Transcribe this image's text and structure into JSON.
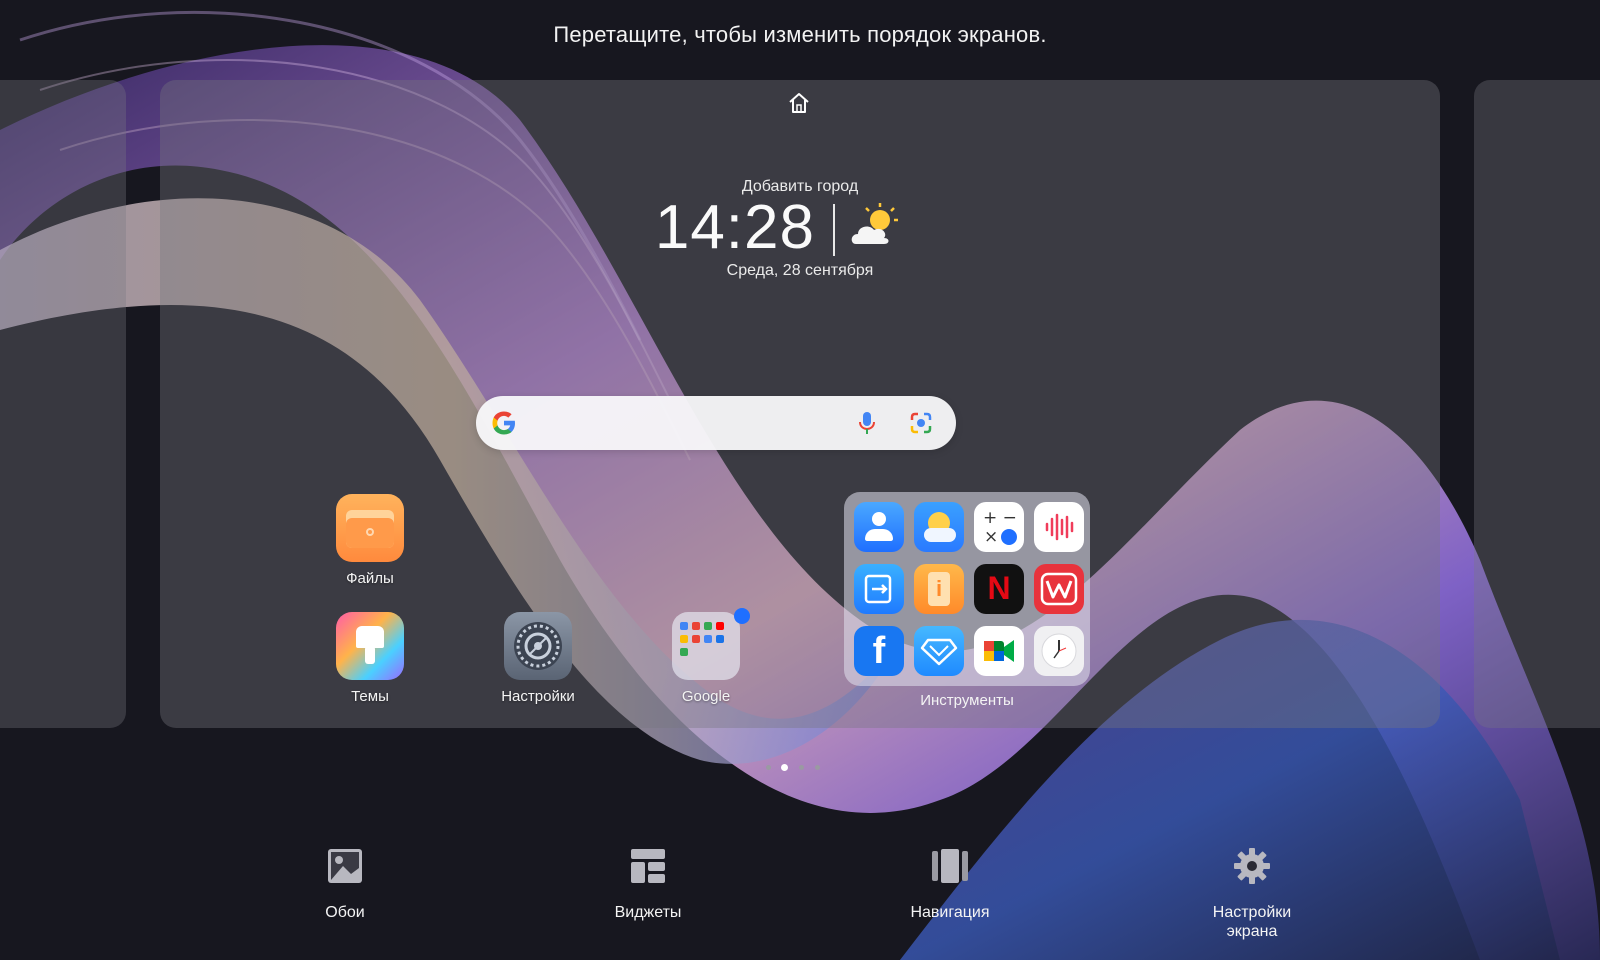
{
  "hint": "Перетащите, чтобы изменить порядок экранов.",
  "clock_widget": {
    "city": "Добавить город",
    "time": "14:28",
    "date": "Среда, 28 сентября",
    "weather_icon": "partly-sunny-icon"
  },
  "search": {
    "placeholder": "",
    "logo_icon": "google-g-icon",
    "mic_icon": "mic-icon",
    "lens_icon": "google-lens-icon"
  },
  "apps": {
    "files": "Файлы",
    "themes": "Темы",
    "settings": "Настройки",
    "google": "Google"
  },
  "folder": {
    "label": "Инструменты",
    "items": [
      "contacts-icon",
      "weather-icon",
      "calculator-icon",
      "recorder-icon",
      "phone-clone-icon",
      "tips-icon",
      "netflix-icon",
      "wps-office-icon",
      "facebook-icon",
      "honor-club-icon",
      "google-meet-icon",
      "clock-icon"
    ]
  },
  "page_indicator": {
    "pages": 4,
    "active": 2
  },
  "bottom_bar": {
    "wallpaper": "Обои",
    "widgets": "Виджеты",
    "navigation": "Навигация",
    "screen_settings_line1": "Настройки",
    "screen_settings_line2": "экрана"
  },
  "colors": {
    "accent_blue": "#1f6fff",
    "panel": "#76767e"
  }
}
